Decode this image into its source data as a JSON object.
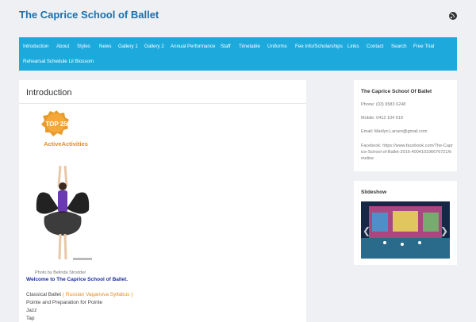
{
  "site": {
    "title": "The Caprice School of Ballet"
  },
  "nav": {
    "items": [
      "Introduction",
      "About",
      "Styles",
      "News",
      "Gallery 1",
      "Gallery 2",
      "Annual Performance",
      "Staff",
      "Timetable",
      "Uniforms",
      "Fee Info/Scholarships",
      "Links",
      "Contact",
      "Search",
      "Free Trial",
      "Rehearsal Schedule Lil Blossom"
    ]
  },
  "main": {
    "title": "Introduction",
    "badge_title": "TOP 25",
    "badge_brand": "ActiveActivities",
    "photo_caption": "Photo by Belinda Strodder",
    "welcome": "Welcome to The Caprice School of Ballet.",
    "classical_prefix": "Classical Ballet",
    "classical_link": "( Russian Vaganova  Syllabus )",
    "pointe": "Pointe and Preparation for Pointe",
    "jazz": "Jazz",
    "tap": "Tap"
  },
  "sidebar": {
    "contact_title": "The Caprice School Of Ballet",
    "phone": "Phone: (03) 9583 6248",
    "mobile": "Mobile: 0412 104 619",
    "email": "Email: Marilyn.Larsen@gmail.com",
    "facebook": "Facebook: https://www.facebook.com/The-Caprice-School-of-Ballet-2016-400410196676721/timeline",
    "slideshow_title": "Slideshow",
    "prev_arrow": "❮",
    "next_arrow": "❯"
  },
  "colors": {
    "nav_bg": "#1da9dc",
    "title_blue": "#1e6faa",
    "welcome_blue": "#1b2f9e",
    "link_orange": "#e58a1f"
  }
}
